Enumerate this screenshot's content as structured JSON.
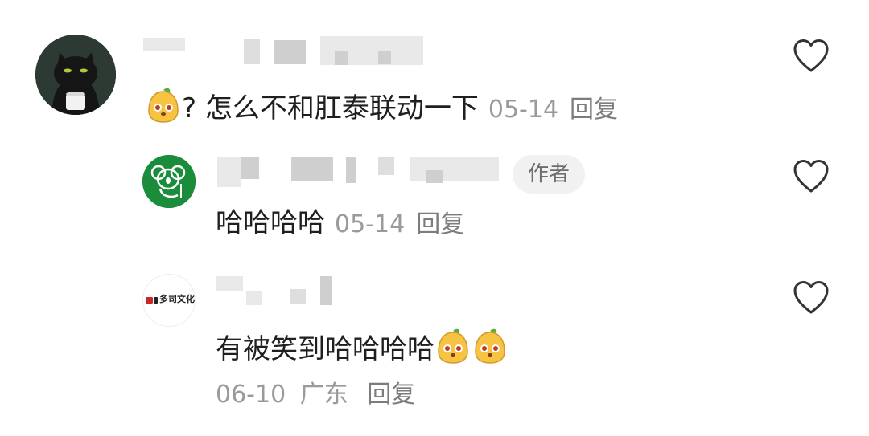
{
  "comments": [
    {
      "text": "? 怎么不和肛泰联动一下",
      "date": "05-14",
      "reply": "回复"
    },
    {
      "badge": "作者",
      "text": "哈哈哈哈",
      "date": "05-14",
      "reply": "回复"
    },
    {
      "avatar_text": "多司文化",
      "text": "有被笑到哈哈哈哈",
      "date": "06-10",
      "location": "广东",
      "reply": "回复"
    }
  ],
  "icons": {
    "like": "heart-outline-icon",
    "emoji": "orange-blob-emoji-icon"
  },
  "colors": {
    "text": "#1f1f1f",
    "meta": "#9a9a9a",
    "badge_bg": "#f1f1f1",
    "avatar_green": "#1a8c3c"
  }
}
